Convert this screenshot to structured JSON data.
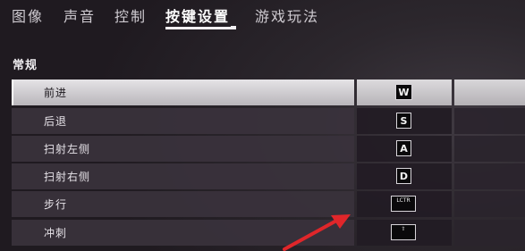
{
  "tabs": [
    {
      "label": "图像",
      "active": false
    },
    {
      "label": "声音",
      "active": false
    },
    {
      "label": "控制",
      "active": false
    },
    {
      "label": "按键设置",
      "active": true
    },
    {
      "label": "游戏玩法",
      "active": false
    }
  ],
  "section": {
    "title": "常规"
  },
  "bindings": [
    {
      "action": "前进",
      "key": "W",
      "selected": true
    },
    {
      "action": "后退",
      "key": "S",
      "selected": false
    },
    {
      "action": "扫射左侧",
      "key": "A",
      "selected": false
    },
    {
      "action": "扫射右侧",
      "key": "D",
      "selected": false
    },
    {
      "action": "步行",
      "key": "LCTR",
      "selected": false
    },
    {
      "action": "冲刺",
      "key": "⇧",
      "selected": false
    }
  ],
  "annotation": {
    "color": "#e0262a",
    "type": "arrow-pointing-to-walk-key"
  },
  "colors": {
    "background": "#231d23",
    "selected_row": "#d6d4d7",
    "accent_text": "#ffffff"
  }
}
